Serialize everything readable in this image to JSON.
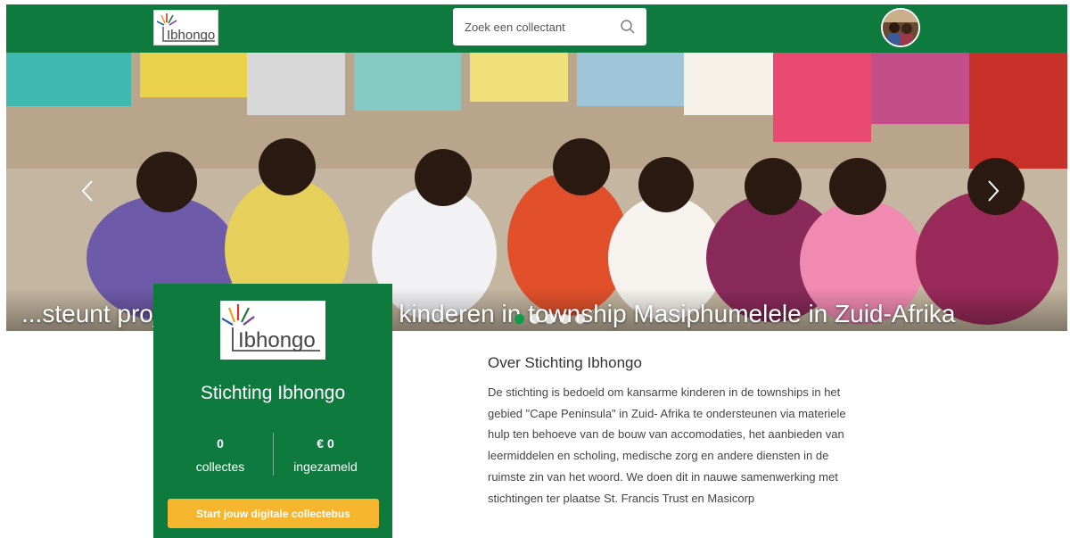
{
  "header": {
    "logo_text": "Ibhongo",
    "search": {
      "placeholder": "Zoek een collectant"
    }
  },
  "hero": {
    "caption": "...steunt projecten voor kansarme kinderen in township Masiphumelele in Zuid-Afrika",
    "slide_count": 5,
    "active_slide": 1
  },
  "profile": {
    "logo_text": "Ibhongo",
    "name": "Stichting Ibhongo",
    "stats": [
      {
        "value": "0",
        "label": "collectes"
      },
      {
        "value": "€ 0",
        "label": "ingezameld"
      }
    ],
    "cta_label": "Start jouw digitale collectebus"
  },
  "about": {
    "title": "Over Stichting Ibhongo",
    "body": "De stichting is bedoeld om kansarme kinderen in de townships in het gebied \"Cape Peninsula\" in Zuid- Afrika te ondersteunen via materiele hulp ten behoeve van de bouw van accomodaties, het aanbieden van leermiddelen en scholing, medische zorg en andere diensten in de ruimste zin van het woord. We doen dit in nauwe samenwerking met stichtingen ter plaatse St. Francis Trust en Masicorp"
  },
  "colors": {
    "brand_green": "#0e7a3e",
    "cta_yellow": "#f6b52e",
    "active_dot": "#0e9a4a"
  }
}
